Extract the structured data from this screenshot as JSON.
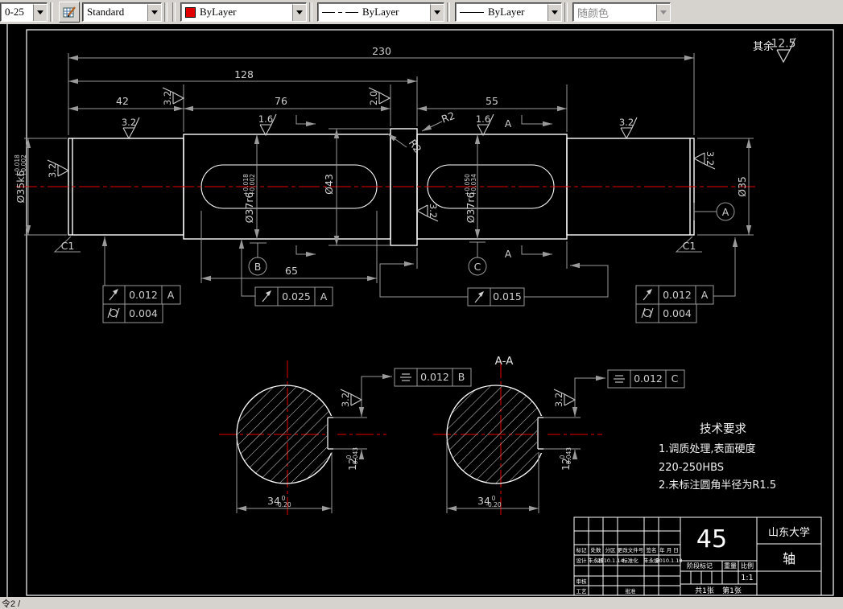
{
  "toolbar": {
    "layer_value": "0-25",
    "style_value": "Standard",
    "color_value": "ByLayer",
    "linetype_value": "ByLayer",
    "lineweight_value": "ByLayer",
    "plotstyle_value": "随颜色"
  },
  "statusbar": {
    "command_text": "令2 /"
  },
  "drawing": {
    "general_roughness": {
      "prefix": "其余",
      "value": "12.5"
    },
    "dims": {
      "len_230": "230",
      "len_128": "128",
      "len_42": "42",
      "len_76": "76",
      "len_55": "55",
      "len_65": "65",
      "dia_35k6": "Ø35k6",
      "dia_35k6_sup": "+0.018",
      "dia_35k6_sub": "+0.002",
      "dia_37r6_left": "Ø37r6",
      "dia_37r6_left_sup": "+0.018",
      "dia_37r6_left_sub": "+0.002",
      "dia_43": "Ø43",
      "dia_37r6_right": "Ø37r6",
      "dia_37r6_right_sup": "+0.050",
      "dia_37r6_right_sub": "+0.034",
      "dia_35": "Ø35"
    },
    "roughness": {
      "shoulder_left": "3.2",
      "shoulder_collar": "2.0",
      "sec1_top": "3.2",
      "sec2_top": "1.6",
      "sec3_top": "1.6",
      "sec4_top": "3.2",
      "left_end": "3.2",
      "right_end": "3.2",
      "collar_right": "3.2",
      "keyway_left": "3.2",
      "keyway_right": "3.2"
    },
    "chamfer_left": "C1",
    "chamfer_right": "C1",
    "fillet_a": "R2",
    "fillet_b": "R2",
    "datum_a": "A",
    "datum_b": "B",
    "datum_c": "C",
    "section_arrow_top": "A",
    "section_arrow_bottom": "A",
    "frames": {
      "f1_value": "0.012",
      "f1_datum": "A",
      "f1b_value": "0.004",
      "f2_value": "0.025",
      "f2_datum": "A",
      "f3_value": "0.015",
      "f4_value": "0.012",
      "f4_datum": "A",
      "f4b_value": "0.004",
      "f5_value": "0.012",
      "f5_datum": "B",
      "f6_value": "0.012",
      "f6_datum": "C"
    },
    "section_view": {
      "label": "A-A",
      "width": "34",
      "width_sup": "0",
      "width_sub": "-0.20",
      "depth": "12",
      "depth_sup": "0",
      "depth_sub": "-0.043"
    },
    "tech": {
      "title": "技术要求",
      "line1": "1.调质处理,表面硬度",
      "line2": "220-250HBS",
      "line3": "2.未标注圆角半径为R1.5"
    },
    "title_block": {
      "material": "45",
      "org": "山东大学",
      "part": "轴",
      "headers": [
        "标记",
        "处数",
        "分区",
        "更改文件号",
        "签名",
        "年 月 日"
      ],
      "design_row": [
        "设计",
        "朱永振",
        "2010.1.14",
        "标准化",
        "朱永振",
        "2010.1.10"
      ],
      "audit": "审核",
      "process": "工艺",
      "approve": "批准",
      "stage": "阶段标记",
      "weight": "重量",
      "scale_label": "比例",
      "scale": "1:1",
      "sheets": "共1张",
      "sheet_no": "第1张"
    }
  }
}
